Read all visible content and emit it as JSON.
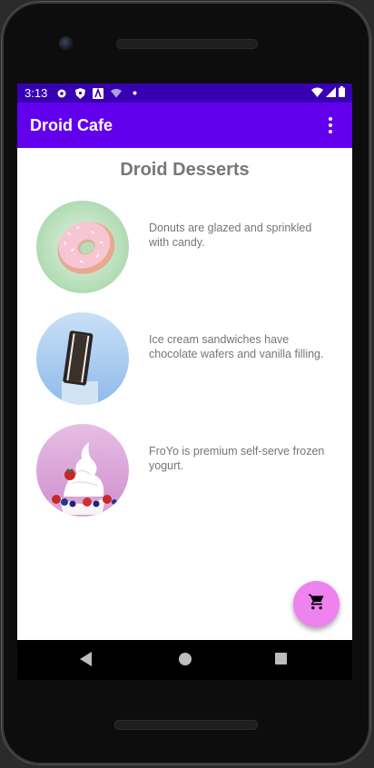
{
  "status_bar": {
    "time": "3:13",
    "left_icons": [
      "settings-icon",
      "shield-icon",
      "a-icon",
      "wifi-question-icon",
      "dot-icon"
    ],
    "right_icons": [
      "wifi-icon",
      "signal-icon",
      "battery-icon"
    ]
  },
  "app_bar": {
    "title": "Droid Cafe",
    "overflow_icon": "more-vert-icon",
    "color": "#6200ee"
  },
  "page": {
    "heading": "Droid Desserts"
  },
  "desserts": [
    {
      "name": "donut",
      "description": "Donuts are glazed and sprinkled with candy."
    },
    {
      "name": "ice-cream-sandwich",
      "description": "Ice cream sandwiches have chocolate wafers and vanilla filling."
    },
    {
      "name": "froyo",
      "description": "FroYo is premium self-serve frozen yogurt."
    }
  ],
  "fab": {
    "icon": "shopping-cart-icon",
    "color": "#ee82ee"
  },
  "nav_bar": {
    "buttons": [
      "back",
      "home",
      "recents"
    ]
  }
}
